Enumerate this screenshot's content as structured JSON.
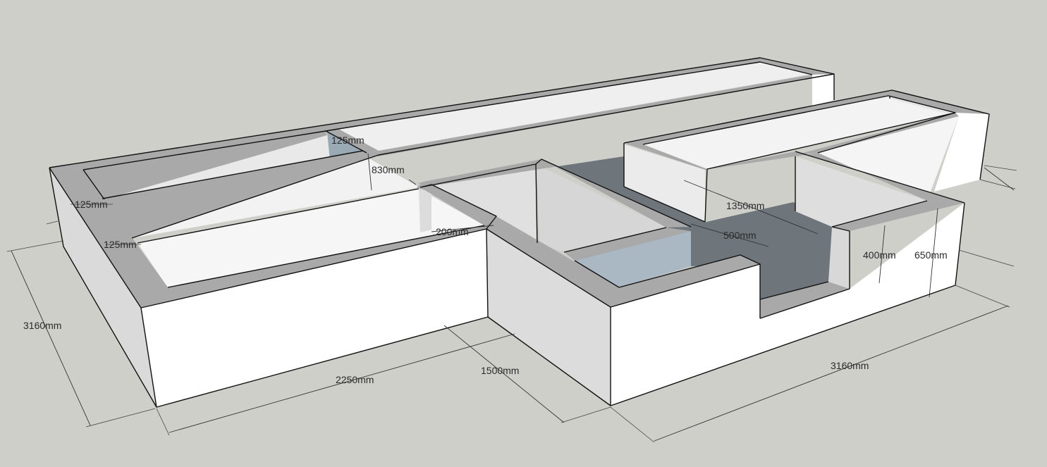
{
  "dimensions": {
    "width_left": "3160mm",
    "length_front_left": "2250mm",
    "depth_step": "1500mm",
    "width_right": "3160mm",
    "wall_thickness_top": "125mm",
    "wall_thickness_side_1": "125mm",
    "wall_thickness_side_2": "125mm",
    "inner_gap": "830mm",
    "wall_200": "200mm",
    "bay_width": "1350mm",
    "bay_depth": "500mm",
    "step_height": "400mm",
    "wall_height": "650mm"
  },
  "colors": {
    "background": "#cfcfca",
    "face_light": "#ffffff",
    "face_side": "#d8d8d8",
    "wall_top": "#a9a9a9",
    "floor_dark": "#6e757b",
    "floor_blue": "#a9b8c2"
  }
}
